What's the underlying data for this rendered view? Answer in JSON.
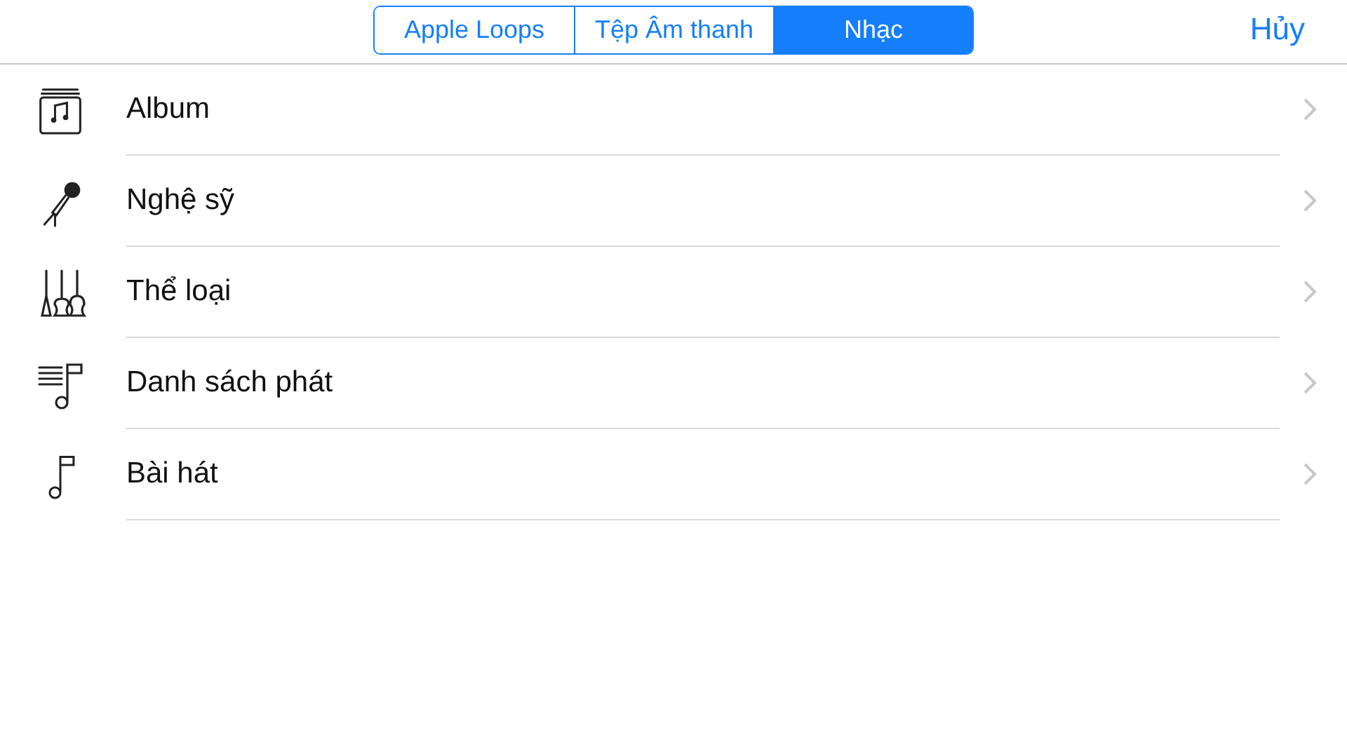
{
  "segments": [
    {
      "label": "Apple Loops",
      "selected": false
    },
    {
      "label": "Tệp Âm thanh",
      "selected": false
    },
    {
      "label": "Nhạc",
      "selected": true
    }
  ],
  "cancel": "Hủy",
  "items": [
    {
      "kind": "album",
      "label": "Album"
    },
    {
      "kind": "artist",
      "label": "Nghệ sỹ"
    },
    {
      "kind": "genre",
      "label": "Thể loại"
    },
    {
      "kind": "playlist",
      "label": "Danh sách phát"
    },
    {
      "kind": "song",
      "label": "Bài hát"
    }
  ]
}
